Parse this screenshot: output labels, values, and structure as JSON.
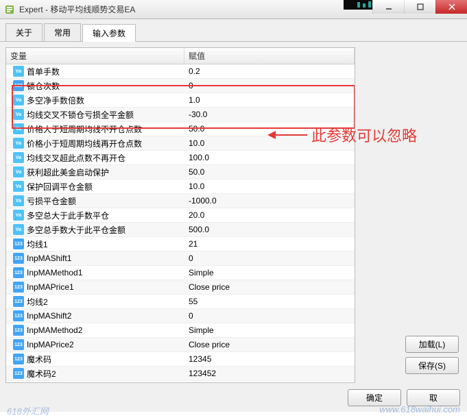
{
  "window": {
    "title": "Expert - 移动平均线顺势交易EA"
  },
  "tabs": [
    {
      "label": "关于",
      "active": false
    },
    {
      "label": "常用",
      "active": false
    },
    {
      "label": "输入参数",
      "active": true
    }
  ],
  "table": {
    "header_var": "变量",
    "header_val": "赋值",
    "rows": [
      {
        "icon": "va",
        "name": "首单手数",
        "value": "0.2"
      },
      {
        "icon": "n123",
        "name": "锁仓次数",
        "value": "0"
      },
      {
        "icon": "va",
        "name": "多空净手数倍数",
        "value": "1.0"
      },
      {
        "icon": "va",
        "name": "均线交叉不锁仓亏损全平金额",
        "value": "-30.0"
      },
      {
        "icon": "va",
        "name": "价格大于短周期均线不开仓点数",
        "value": "50.0"
      },
      {
        "icon": "va",
        "name": "价格小于短周期均线再开仓点数",
        "value": "10.0"
      },
      {
        "icon": "va",
        "name": "均线交叉超此点数不再开仓",
        "value": "100.0"
      },
      {
        "icon": "va",
        "name": "获利超此美金启动保护",
        "value": "50.0"
      },
      {
        "icon": "va",
        "name": "保护回调平仓金额",
        "value": "10.0"
      },
      {
        "icon": "va",
        "name": "亏损平仓金额",
        "value": "-1000.0"
      },
      {
        "icon": "va",
        "name": "多空总大于此手数平仓",
        "value": "20.0"
      },
      {
        "icon": "va",
        "name": "多空总手数大于此平仓金额",
        "value": "500.0"
      },
      {
        "icon": "n123",
        "name": "均线1",
        "value": "21"
      },
      {
        "icon": "n123",
        "name": "InpMAShift1",
        "value": "0"
      },
      {
        "icon": "n123",
        "name": "InpMAMethod1",
        "value": "Simple"
      },
      {
        "icon": "n123",
        "name": "InpMAPrice1",
        "value": "Close price"
      },
      {
        "icon": "n123",
        "name": "均线2",
        "value": "55"
      },
      {
        "icon": "n123",
        "name": "InpMAShift2",
        "value": "0"
      },
      {
        "icon": "n123",
        "name": "InpMAMethod2",
        "value": "Simple"
      },
      {
        "icon": "n123",
        "name": "InpMAPrice2",
        "value": "Close price"
      },
      {
        "icon": "n123",
        "name": "魔术码",
        "value": "12345"
      },
      {
        "icon": "n123",
        "name": "魔术码2",
        "value": "123452"
      }
    ]
  },
  "annotation": {
    "text": "此参数可以忽略"
  },
  "buttons": {
    "load": "加载(L)",
    "save": "保存(S)",
    "ok": "确定",
    "cancel": "取"
  },
  "watermark": {
    "left": "618外汇网",
    "right": "www.618waihui.com"
  },
  "icon_labels": {
    "va": "Va",
    "n123": "123"
  }
}
